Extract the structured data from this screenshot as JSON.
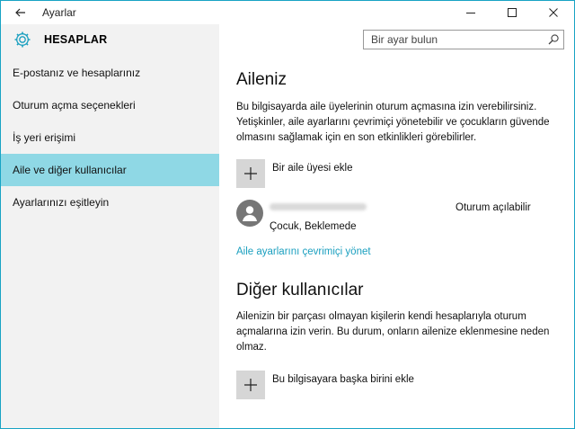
{
  "window": {
    "title": "Ayarlar"
  },
  "sidebar": {
    "header": "HESAPLAR",
    "items": [
      {
        "label": "E-postanız ve hesaplarınız",
        "active": false
      },
      {
        "label": "Oturum açma seçenekleri",
        "active": false
      },
      {
        "label": "İş yeri erişimi",
        "active": false
      },
      {
        "label": "Aile ve diğer kullanıcılar",
        "active": true
      },
      {
        "label": "Ayarlarınızı eşitleyin",
        "active": false
      }
    ]
  },
  "search": {
    "placeholder": "Bir ayar bulun"
  },
  "family": {
    "title": "Aileniz",
    "description": "Bu bilgisayarda aile üyelerinin oturum açmasına izin verebilirsiniz. Yetişkinler, aile ayarlarını çevrimiçi yönetebilir ve çocukların güvende olmasını sağlamak için en son etkinlikleri görebilirler.",
    "add_label": "Bir aile üyesi ekle",
    "member": {
      "status": "Oturum açılabilir",
      "role": "Çocuk, Beklemede"
    },
    "manage_link": "Aile ayarlarını çevrimiçi yönet"
  },
  "others": {
    "title": "Diğer kullanıcılar",
    "description": "Ailenizin bir parçası olmayan kişilerin kendi hesaplarıyla oturum açmalarına izin verin. Bu durum, onların ailenize eklenmesine neden olmaz.",
    "add_label": "Bu bilgisayara başka birini ekle"
  },
  "colors": {
    "accent": "#8fd8e5",
    "link": "#1a9fbf",
    "border": "#18a3c4"
  }
}
